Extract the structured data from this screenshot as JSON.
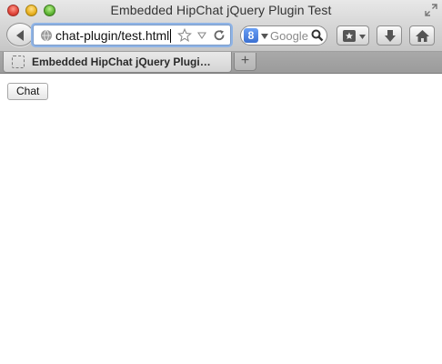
{
  "window": {
    "title": "Embedded HipChat jQuery Plugin Test"
  },
  "navbar": {
    "url": "chat-plugin/test.html",
    "search_placeholder": "Google",
    "search_engine_letter": "8"
  },
  "tabs": [
    {
      "label": "Embedded HipChat jQuery Plugi…",
      "active": true
    }
  ],
  "newtab_label": "+",
  "page": {
    "chat_button_label": "Chat"
  },
  "icons": {
    "back": "back-arrow-icon",
    "globe": "globe-icon",
    "star": "star-icon",
    "reload": "reload-icon",
    "magnifier": "magnifier-icon",
    "bookmarks": "bookmarks-icon",
    "downloads": "download-arrow-icon",
    "home": "home-icon"
  }
}
